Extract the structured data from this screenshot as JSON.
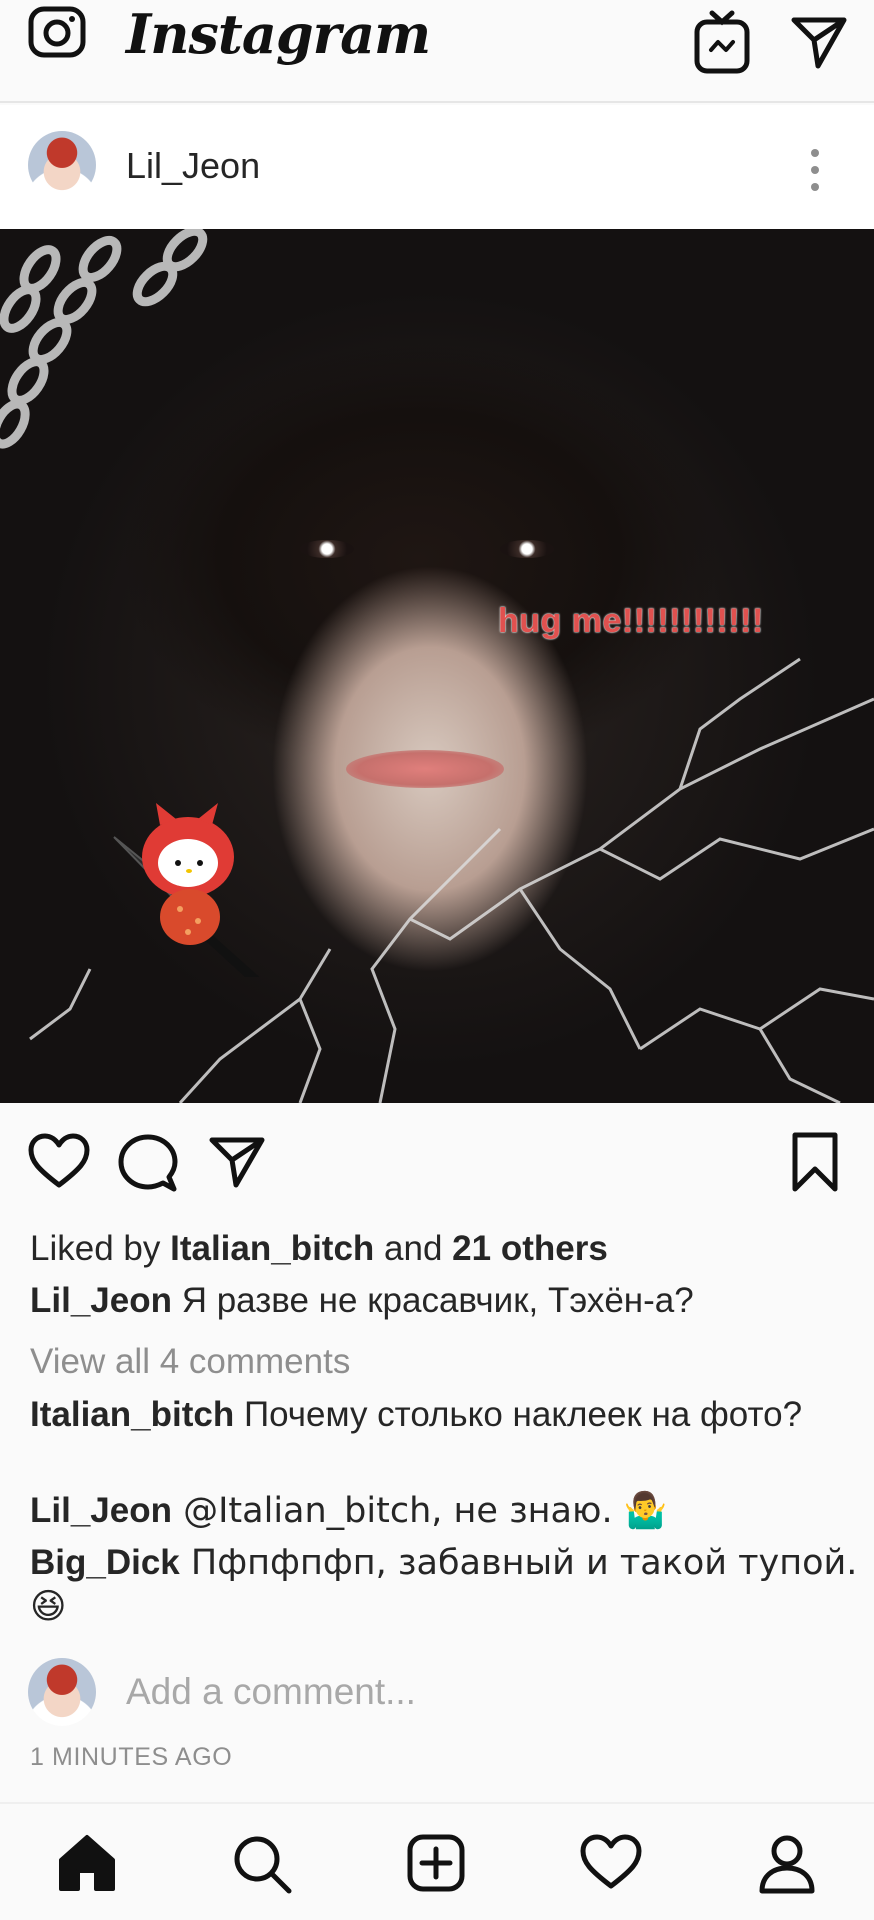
{
  "header": {
    "app_title": "Instagram",
    "icons": [
      "camera-icon",
      "igtv-icon",
      "direct-message-icon"
    ]
  },
  "post": {
    "username": "Lil_Jeon",
    "photo_sticker_text": "hug me!!!!!!!!!!!!",
    "likes": {
      "prefix": "Liked by ",
      "liker": "Italian_bitch",
      "middle": " and ",
      "others": "21 others"
    },
    "caption": {
      "user": "Lil_Jeon",
      "text": " Я разве не красавчик, Тэхён-а?"
    },
    "view_all_comments": "View all 4 comments",
    "comments": [
      {
        "user": "Italian_bitch",
        "text": " Почему столько наклеек на фото?"
      },
      {
        "user": "Lil_Jeon",
        "text": " @Italian_bitch, не знаю. 🤷‍♂️"
      },
      {
        "user": "Big_Dick",
        "text": " Пфпфпфп, забавный и такой тупой. 😆"
      }
    ],
    "add_comment_placeholder": "Add a comment...",
    "timestamp": "1 MINUTES AGO"
  },
  "colors": {
    "text": "#262626",
    "secondary": "#8e8e8e",
    "background": "#fafafa",
    "sticker_red": "#e0514f"
  },
  "bottom_nav": [
    "home-icon",
    "search-icon",
    "new-post-icon",
    "activity-heart-icon",
    "profile-icon"
  ]
}
